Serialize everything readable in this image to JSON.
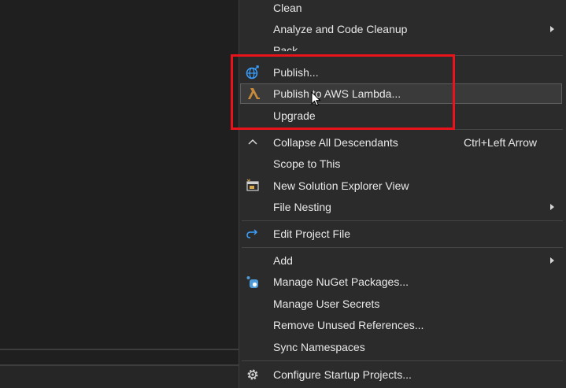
{
  "menu": {
    "items": [
      {
        "label": "Clean"
      },
      {
        "label": "Analyze and Code Cleanup",
        "icon": "chevron-right-icon"
      },
      {
        "label": "Pack"
      },
      {
        "label": "Publish...",
        "icon": "globe-publish-icon"
      },
      {
        "label": "Publish to AWS Lambda...",
        "icon": "aws-lambda-icon"
      },
      {
        "label": "Upgrade"
      },
      {
        "label": "Collapse All Descendants",
        "shortcut": "Ctrl+Left Arrow",
        "icon": "chevron-up-icon"
      },
      {
        "label": "Scope to This"
      },
      {
        "label": "New Solution Explorer View",
        "icon": "new-window-icon"
      },
      {
        "label": "File Nesting"
      },
      {
        "label": "Edit Project File",
        "icon": "edit-redo-arrow-icon"
      },
      {
        "label": "Add"
      },
      {
        "label": "Manage NuGet Packages...",
        "icon": "nuget-icon"
      },
      {
        "label": "Manage User Secrets"
      },
      {
        "label": "Remove Unused References..."
      },
      {
        "label": "Sync Namespaces"
      },
      {
        "label": "Configure Startup Projects...",
        "icon": "gear-icon"
      }
    ]
  },
  "colors": {
    "menu_bg": "#2b2b2b",
    "highlight_box": "#e8131b",
    "hover_bg": "#3a3a3a",
    "publish_icon": "#3aa0ff",
    "lambda_icon": "#c98a3a"
  }
}
